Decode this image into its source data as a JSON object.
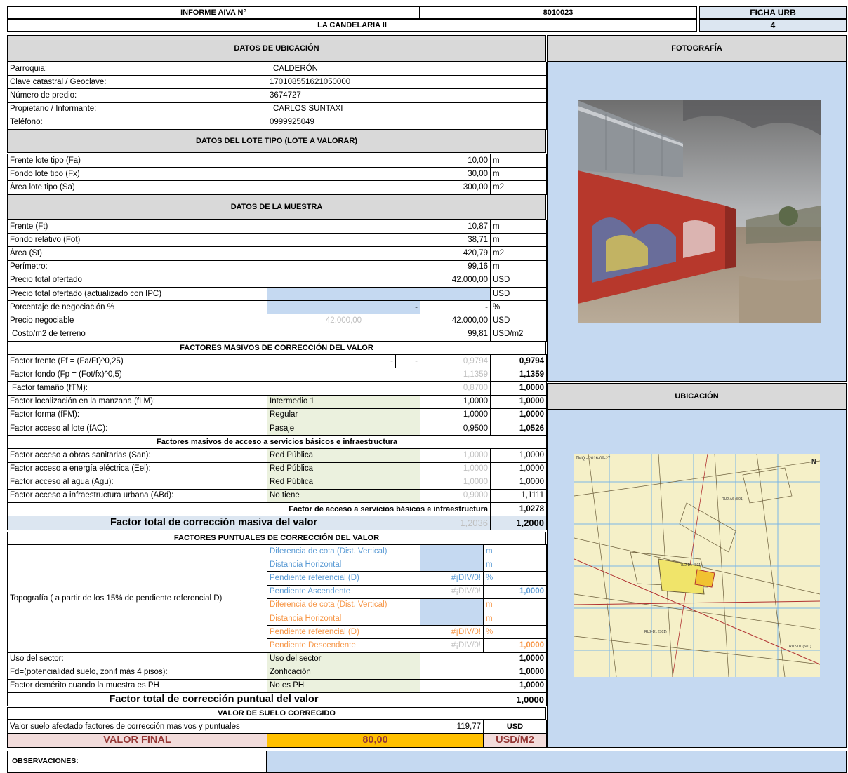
{
  "header": {
    "informe_label": "INFORME AIVA N°",
    "informe_number": "8010023",
    "ficha_label": "FICHA URB",
    "ficha_number": "4",
    "project_name": "LA CANDELARIA II"
  },
  "ubicacion": {
    "title": "DATOS DE UBICACIÓN",
    "rows": [
      {
        "label": "Parroquia:",
        "value": "CALDERÓN"
      },
      {
        "label": "Clave catastral / Geoclave:",
        "value": "170108551621050000"
      },
      {
        "label": "Número de predio:",
        "value": "3674727"
      },
      {
        "label": "Propietario / Informante:",
        "value": "CARLOS SUNTAXI"
      },
      {
        "label": "Teléfono:",
        "value": "0999925049"
      }
    ]
  },
  "lote_tipo": {
    "title": "DATOS DEL LOTE TIPO (LOTE A VALORAR)",
    "rows": [
      {
        "label": "Frente lote tipo (Fa)",
        "value": "10,00",
        "unit": "m"
      },
      {
        "label": "Fondo lote tipo (Fx)",
        "value": "30,00",
        "unit": "m"
      },
      {
        "label": "Área lote tipo (Sa)",
        "value": "300,00",
        "unit": "m2"
      }
    ]
  },
  "muestra": {
    "title": "DATOS DE LA MUESTRA",
    "rows": [
      {
        "label": "Frente (Ft)",
        "value": "10,87",
        "unit": "m"
      },
      {
        "label": "Fondo relativo (Fot)",
        "value": "38,71",
        "unit": "m"
      },
      {
        "label": "Área (St)",
        "value": "420,79",
        "unit": "m2"
      },
      {
        "label": "Perímetro:",
        "value": "99,16",
        "unit": "m"
      },
      {
        "label": "Precio total ofertado",
        "value": "42.000,00",
        "unit": "USD"
      },
      {
        "label": "Precio total ofertado (actualizado con IPC)",
        "value": "",
        "unit": "USD"
      }
    ],
    "negociacion_label": "Porcentaje de negociación %",
    "negociacion_a": "-",
    "negociacion_b": "-",
    "negociacion_unit": "%",
    "precio_neg_label": "Precio negociable",
    "precio_neg_gray": "42.000,00",
    "precio_neg_value": "42.000,00",
    "precio_neg_unit": "USD",
    "costo_label": "Costo/m2 de terreno",
    "costo_value": "99,81",
    "costo_unit": "USD/m2"
  },
  "masivos": {
    "title": "FACTORES MASIVOS DE CORRECCIÓN DEL VALOR",
    "frente": {
      "label": "Factor frente (Ff = (Fa/Ft)^0,25)",
      "d1": "-",
      "d2": "-",
      "gray": "0,9794",
      "value": "0,9794"
    },
    "fondo": {
      "label": "Factor fondo (Fp = (Fot/fx)^0,5)",
      "gray": "1,1359",
      "value": "1,1359"
    },
    "tamano": {
      "label": "Factor tamaño (fTM):",
      "gray": "0,8700",
      "value": "1,0000"
    },
    "rows": [
      {
        "label": "Factor localización en la manzana (fLM):",
        "option": "Intermedio 1",
        "coef": "1,0000",
        "value": "1,0000"
      },
      {
        "label": "Factor forma (fFM):",
        "option": "Regular",
        "coef": "1,0000",
        "value": "1,0000"
      },
      {
        "label": "Factor acceso al lote (fAC):",
        "option": "Pasaje",
        "coef": "0,9500",
        "value": "1,0526"
      }
    ],
    "servicios_title": "Factores masivos de acceso a servicios básicos e infraestructura",
    "servicios": [
      {
        "label": "Factor acceso a obras sanitarias (San):",
        "option": "Red Pública",
        "coef": "1,0000",
        "value": "1,0000"
      },
      {
        "label": "Factor acceso a energía eléctrica (Eel):",
        "option": "Red Pública",
        "coef": "1,0000",
        "value": "1,0000"
      },
      {
        "label": "Factor acceso al agua (Agu):",
        "option": "Red Pública",
        "coef": "1,0000",
        "value": "1,0000"
      },
      {
        "label": "Factor acceso a infraestructura urbana (ABd):",
        "option": "No tiene",
        "coef": "0,9000",
        "value": "1,1111"
      }
    ],
    "servicios_total_label": "Factor de acceso a servicios básicos e infraestructura",
    "servicios_total_value": "1,0278",
    "total_label": "Factor total de corrección masiva del valor",
    "total_gray": "1,2036",
    "total_value": "1,2000"
  },
  "puntuales": {
    "title": "FACTORES PUNTUALES DE CORRECCIÓN DEL VALOR",
    "topo_label": "Topografía ( a partir de los 15% de pendiente referencial D)",
    "asc": [
      {
        "label": "Diferencia de cota (Dist. Vertical)",
        "mid": "",
        "unit": "m",
        "value": ""
      },
      {
        "label": "Distancia Horizontal",
        "mid": "",
        "unit": "m",
        "value": ""
      },
      {
        "label": "Pendiente referencial (D)",
        "mid": "#¡DIV/0!",
        "unit": "%",
        "value": ""
      },
      {
        "label": "Pendiente Ascendente",
        "mid": "#¡DIV/0!",
        "unit": "",
        "value": "1,0000"
      }
    ],
    "desc": [
      {
        "label": "Diferencia de cota (Dist. Vertical)",
        "mid": "",
        "unit": "m",
        "value": ""
      },
      {
        "label": "Distancia Horizontal",
        "mid": "",
        "unit": "m",
        "value": ""
      },
      {
        "label": "Pendiente referencial (D)",
        "mid": "#¡DIV/0!",
        "unit": "%",
        "value": ""
      },
      {
        "label": "Pendiente Descendente",
        "mid": "#¡DIV/0!",
        "unit": "",
        "value": "1,0000"
      }
    ],
    "rows": [
      {
        "label": "Uso del sector:",
        "option": "Uso del sector",
        "value": "1,0000"
      },
      {
        "label": "Fd=(potencialidad suelo, zonif más 4 pisos):",
        "option": "Zonficación",
        "value": "1,0000"
      },
      {
        "label": "Factor demérito cuando la muestra es PH",
        "option": "No es PH",
        "value": "1,0000"
      }
    ],
    "total_label": "Factor total de corrección puntual del valor",
    "total_value": "1,0000"
  },
  "corregido": {
    "title": "VALOR DE SUELO CORREGIDO",
    "label": "Valor suelo afectado factores de corrección masivos y puntuales",
    "value": "119,77",
    "unit": "USD"
  },
  "final": {
    "label": "VALOR FINAL",
    "value": "80,00",
    "unit": "USD/M2"
  },
  "observaciones": {
    "label": "OBSERVACIONES:",
    "text": ""
  },
  "photo": {
    "title": "FOTOGRAFÍA"
  },
  "map": {
    "title": "UBICACIÓN",
    "stamp": "TMQ - 2016-09-27",
    "north": "N",
    "labels": [
      "RU2-A6 (S01)",
      "RU2-D1 (S01)",
      "RU2-D1 (S01)",
      "RU2-D1 (S01)"
    ]
  }
}
